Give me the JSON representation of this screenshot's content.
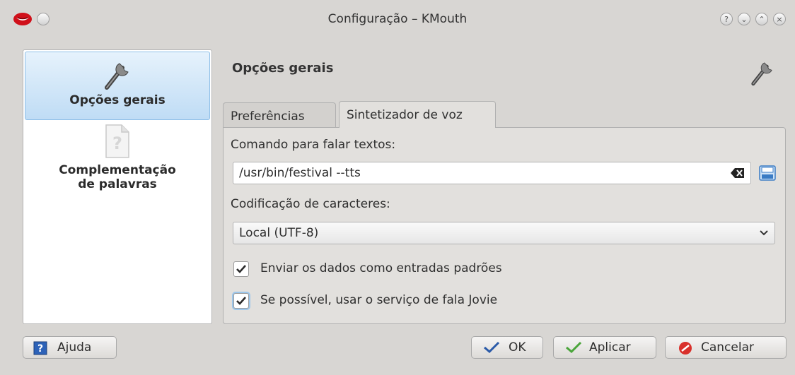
{
  "window": {
    "title": "Configuração – KMouth",
    "title_buttons": [
      "help-icon",
      "minimize-icon",
      "maximize-icon",
      "close-icon"
    ]
  },
  "sidebar": {
    "items": [
      {
        "label": "Opções gerais",
        "icon": "wrench-icon",
        "selected": true
      },
      {
        "label_line1": "Complementação",
        "label_line2": "de palavras",
        "icon": "document-unknown-icon",
        "selected": false
      }
    ]
  },
  "page": {
    "header": "Opções gerais",
    "header_icon": "wrench-icon"
  },
  "tabs": [
    {
      "label": "Preferências",
      "active": false
    },
    {
      "label": "Sintetizador de voz",
      "active": true
    }
  ],
  "speech": {
    "command_label": "Comando para falar textos:",
    "command_value": "/usr/bin/festival --tts",
    "encoding_label": "Codificação de caracteres:",
    "encoding_value": "Local (UTF-8)",
    "stdin_label": "Enviar os dados como entradas padrões",
    "stdin_checked": true,
    "jovie_label": "Se possível, usar o serviço de fala Jovie",
    "jovie_checked": true
  },
  "buttons": {
    "help": "Ajuda",
    "ok": "OK",
    "apply": "Aplicar",
    "cancel": "Cancelar"
  },
  "colors": {
    "selection": "#bfdcf5",
    "window_bg": "#d8d6d3",
    "check_blue": "#2a6fb5",
    "cancel_red": "#d9302b"
  }
}
